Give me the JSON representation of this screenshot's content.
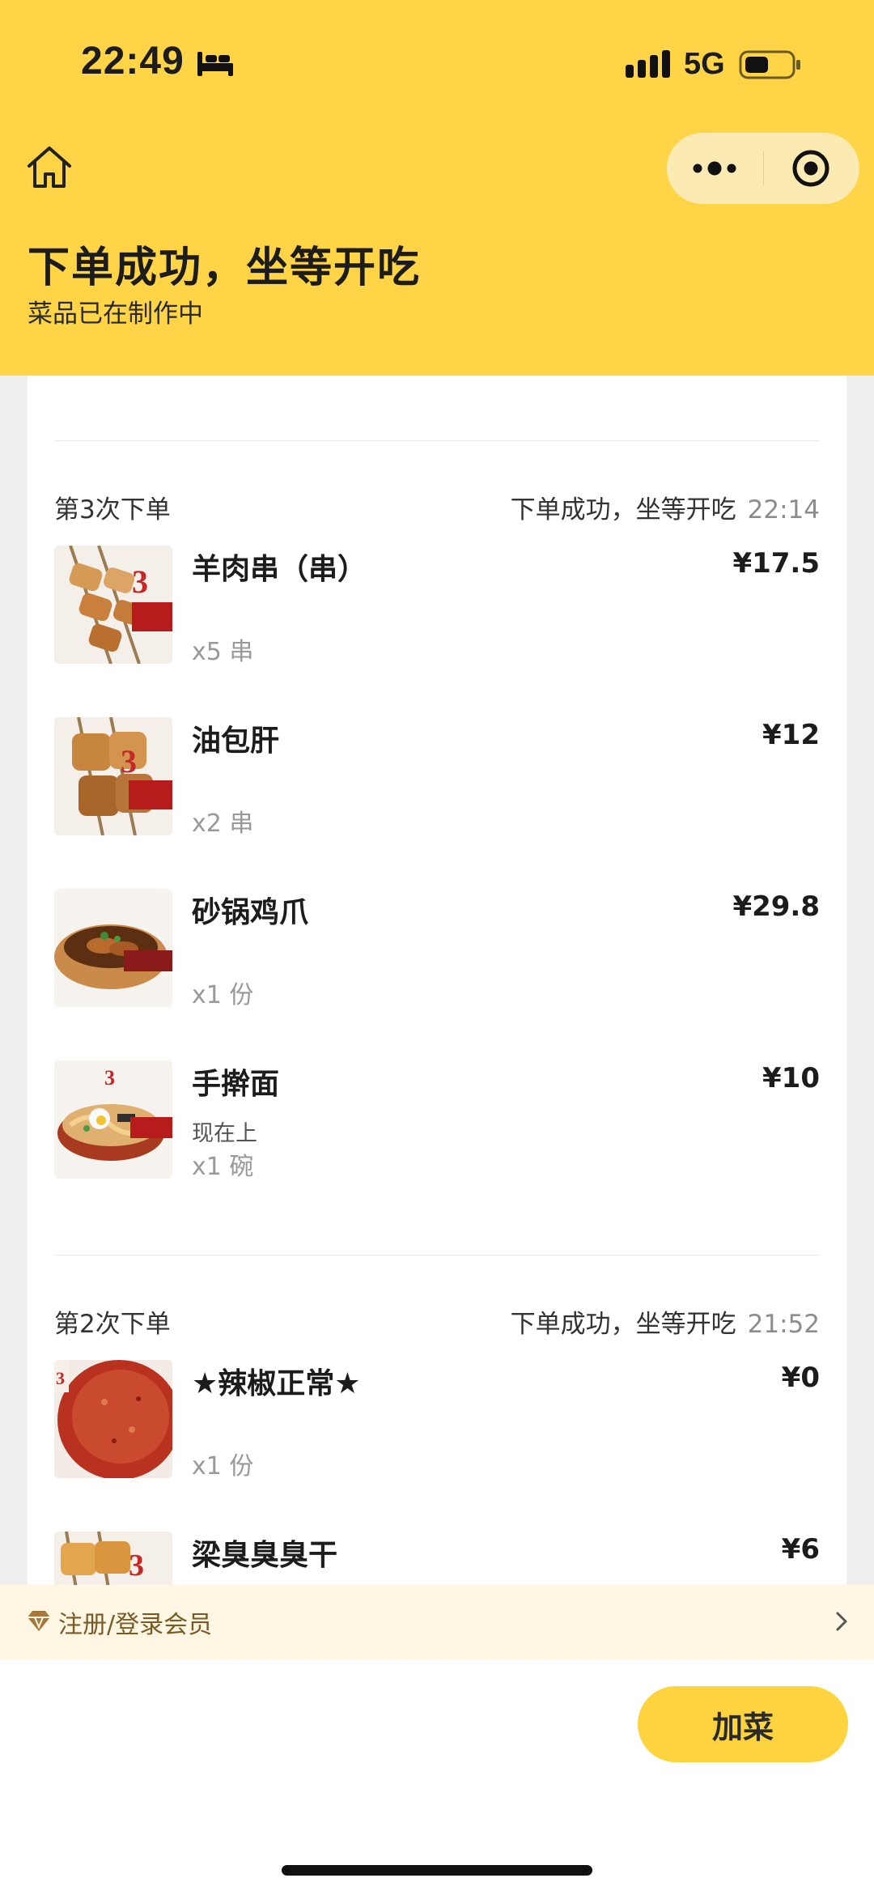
{
  "status_bar": {
    "time": "22:49",
    "network": "5G",
    "icons": [
      "bed-icon",
      "signal-icon",
      "battery-icon"
    ]
  },
  "nav": {
    "home_icon": "home-icon",
    "more_icon": "more-dots-icon",
    "close_icon": "target-close-icon"
  },
  "header": {
    "title": "下单成功，坐等开吃",
    "subtitle": "菜品已在制作中"
  },
  "orders": [
    {
      "label": "第3次下单",
      "status": "下单成功，坐等开吃",
      "time": "22:14",
      "items": [
        {
          "name": "羊肉串（串）",
          "price": "¥17.5",
          "note": "",
          "qty": "x5 串"
        },
        {
          "name": "油包肝",
          "price": "¥12",
          "note": "",
          "qty": "x2 串"
        },
        {
          "name": "砂锅鸡爪",
          "price": "¥29.8",
          "note": "",
          "qty": "x1 份"
        },
        {
          "name": "手擀面",
          "price": "¥10",
          "note": "现在上",
          "qty": "x1 碗"
        }
      ]
    },
    {
      "label": "第2次下单",
      "status": "下单成功，坐等开吃",
      "time": "21:52",
      "items": [
        {
          "name": "★辣椒正常★",
          "price": "¥0",
          "note": "",
          "qty": "x1 份"
        },
        {
          "name": "梁臭臭臭干",
          "price": "¥6",
          "note": "",
          "qty": ""
        }
      ]
    }
  ],
  "member_bar": {
    "label": "注册/登录会员",
    "icon": "diamond-icon"
  },
  "actions": {
    "add_dish": "加菜"
  },
  "colors": {
    "brand_yellow": "#ffd446",
    "button_yellow": "#fdd43f",
    "member_bg": "#fff7e3",
    "member_text": "#7a5a25"
  }
}
